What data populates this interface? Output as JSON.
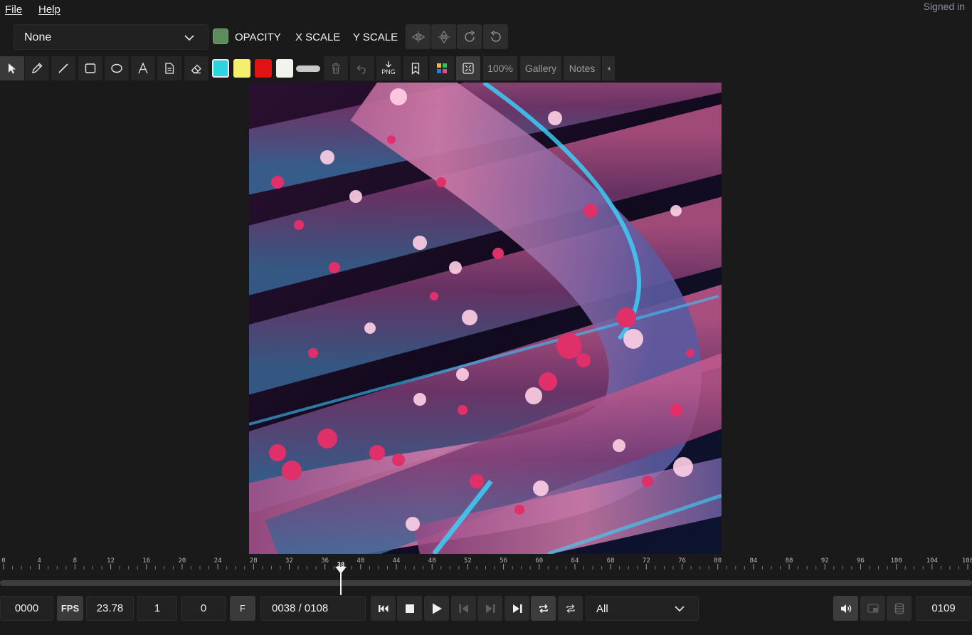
{
  "menu": {
    "file": "File",
    "help": "Help",
    "status": "Signed in"
  },
  "layer_select": {
    "value": "None"
  },
  "transform": {
    "color": "#5c8c5c",
    "opacity_label": "OPACITY",
    "xscale_label": "X SCALE",
    "yscale_label": "Y SCALE"
  },
  "toolbar": {
    "colors": [
      "#2ad4e0",
      "#f5ef6e",
      "#e01414",
      "#f2f2ee"
    ],
    "export_label": "PNG",
    "zoom": "100%",
    "gallery": "Gallery",
    "notes": "Notes"
  },
  "timeline": {
    "start": 0,
    "end": 108,
    "tick_labels": [
      "0",
      "4",
      "8",
      "12",
      "16",
      "20",
      "24",
      "28",
      "32",
      "36",
      "40",
      "44",
      "48",
      "52",
      "56",
      "60",
      "64",
      "68",
      "72",
      "76",
      "80",
      "84",
      "88",
      "92",
      "96",
      "100",
      "104",
      "108"
    ],
    "current_frame_label": "38",
    "current_frame": 38
  },
  "controls": {
    "start_frame": "0000",
    "fps_label": "FPS",
    "fps_value": "23.78",
    "step": "1",
    "offset": "0",
    "frame_mode": "F",
    "frame_counter": "0038 / 0108",
    "range": "All",
    "end_frame": "0109"
  }
}
